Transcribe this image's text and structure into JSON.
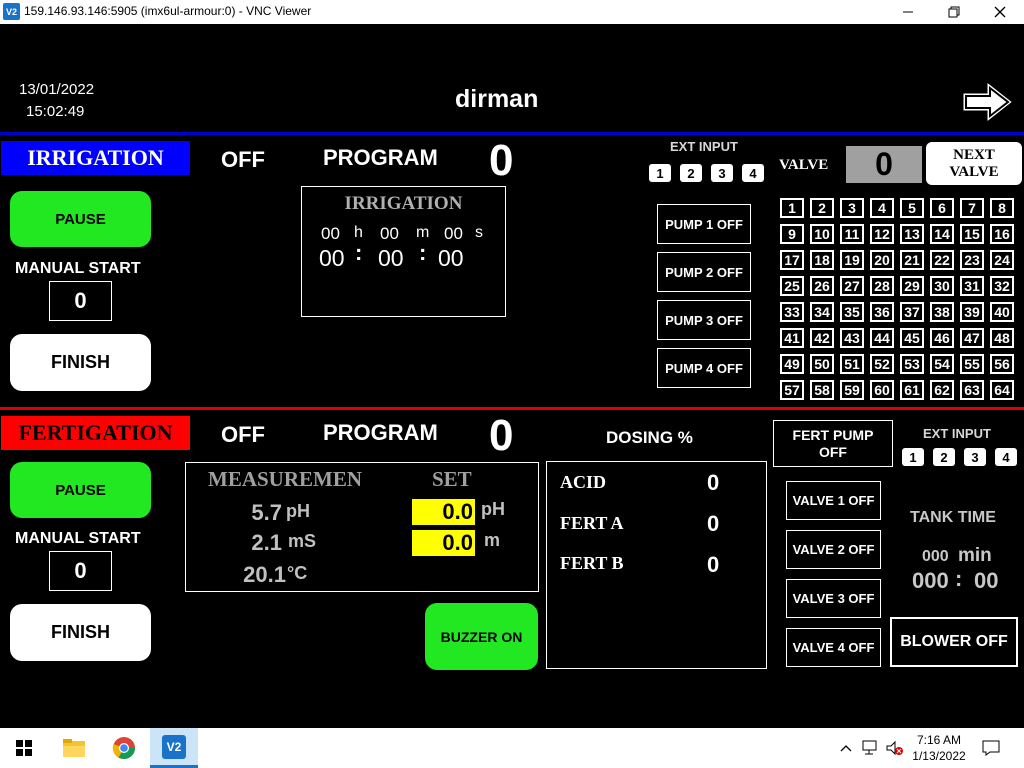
{
  "window": {
    "app_icon": "V2",
    "title": "159.146.93.146:5905 (imx6ul-armour:0) - VNC Viewer",
    "minimize_icon": "minimize-icon",
    "maximize_icon": "restore-icon",
    "close_icon": "close-icon"
  },
  "header": {
    "date": "13/01/2022",
    "time": "15:02:49",
    "project": "dirman"
  },
  "irrigation": {
    "title": "IRRIGATION",
    "status": "OFF",
    "program_label": "PROGRAM",
    "program_value": "0",
    "pause_label": "PAUSE",
    "manual_start_label": "MANUAL START",
    "manual_start_value": "0",
    "finish_label": "FINISH",
    "timer": {
      "header": "IRRIGATION",
      "h_val": "00",
      "h_unit": "h",
      "m_val": "00",
      "m_unit": "m",
      "s_val": "00",
      "s_unit": "s",
      "clock_h": "00",
      "clock_m": "00",
      "clock_s": "00",
      "sep": ":"
    },
    "ext_input_label": "EXT INPUT",
    "ext_inputs": [
      "1",
      "2",
      "3",
      "4"
    ],
    "pumps": [
      "PUMP 1 OFF",
      "PUMP 2 OFF",
      "PUMP 3 OFF",
      "PUMP 4 OFF"
    ],
    "valve_label": "VALVE",
    "valve_value": "0",
    "next_valve_line1": "NEXT",
    "next_valve_line2": "VALVE",
    "valves": [
      "1",
      "2",
      "3",
      "4",
      "5",
      "6",
      "7",
      "8",
      "9",
      "10",
      "11",
      "12",
      "13",
      "14",
      "15",
      "16",
      "17",
      "18",
      "19",
      "20",
      "21",
      "22",
      "23",
      "24",
      "25",
      "26",
      "27",
      "28",
      "29",
      "30",
      "31",
      "32",
      "33",
      "34",
      "35",
      "36",
      "37",
      "38",
      "39",
      "40",
      "41",
      "42",
      "43",
      "44",
      "45",
      "46",
      "47",
      "48",
      "49",
      "50",
      "51",
      "52",
      "53",
      "54",
      "55",
      "56",
      "57",
      "58",
      "59",
      "60",
      "61",
      "62",
      "63",
      "64"
    ]
  },
  "fertigation": {
    "title": "FERTIGATION",
    "status": "OFF",
    "program_label": "PROGRAM",
    "program_value": "0",
    "pause_label": "PAUSE",
    "manual_start_label": "MANUAL START",
    "manual_start_value": "0",
    "finish_label": "FINISH",
    "measurement": {
      "header": "MEASUREMEN",
      "set_header": "SET",
      "ph_value": "5.7",
      "ph_unit": "pH",
      "ec_value": "2.1",
      "ec_unit": "mS",
      "temp_value": "20.1",
      "temp_unit": "°C",
      "set_ph_value": "0.0",
      "set_ph_unit": "pH",
      "set_ec_value": "0.0",
      "set_ec_unit": "m"
    },
    "buzzer_label": "BUZZER ON",
    "dosing_label": "DOSING %",
    "dosing": {
      "acid_label": "ACID",
      "acid_value": "0",
      "ferta_label": "FERT A",
      "ferta_value": "0",
      "fertb_label": "FERT B",
      "fertb_value": "0"
    },
    "fert_pump_line1": "FERT PUMP",
    "fert_pump_line2": "OFF",
    "ext_input_label": "EXT INPUT",
    "ext_inputs": [
      "1",
      "2",
      "3",
      "4"
    ],
    "valves": [
      "VALVE 1 OFF",
      "VALVE 2 OFF",
      "VALVE 3 OFF",
      "VALVE 4 OFF"
    ],
    "tank_time_label": "TANK TIME",
    "tank_min_value": "000",
    "tank_min_unit": "min",
    "tank_clock_m": "000",
    "tank_clock_s": "00",
    "tank_sep": ":",
    "blower_label": "BLOWER OFF"
  },
  "taskbar": {
    "time": "7:16 AM",
    "date": "1/13/2022",
    "vnc_icon_text": "V2"
  },
  "colors": {
    "irrigation_blue": "#0000ff",
    "fertigation_red": "#ff0000",
    "button_green": "#22e822",
    "set_yellow": "#ffff00"
  }
}
